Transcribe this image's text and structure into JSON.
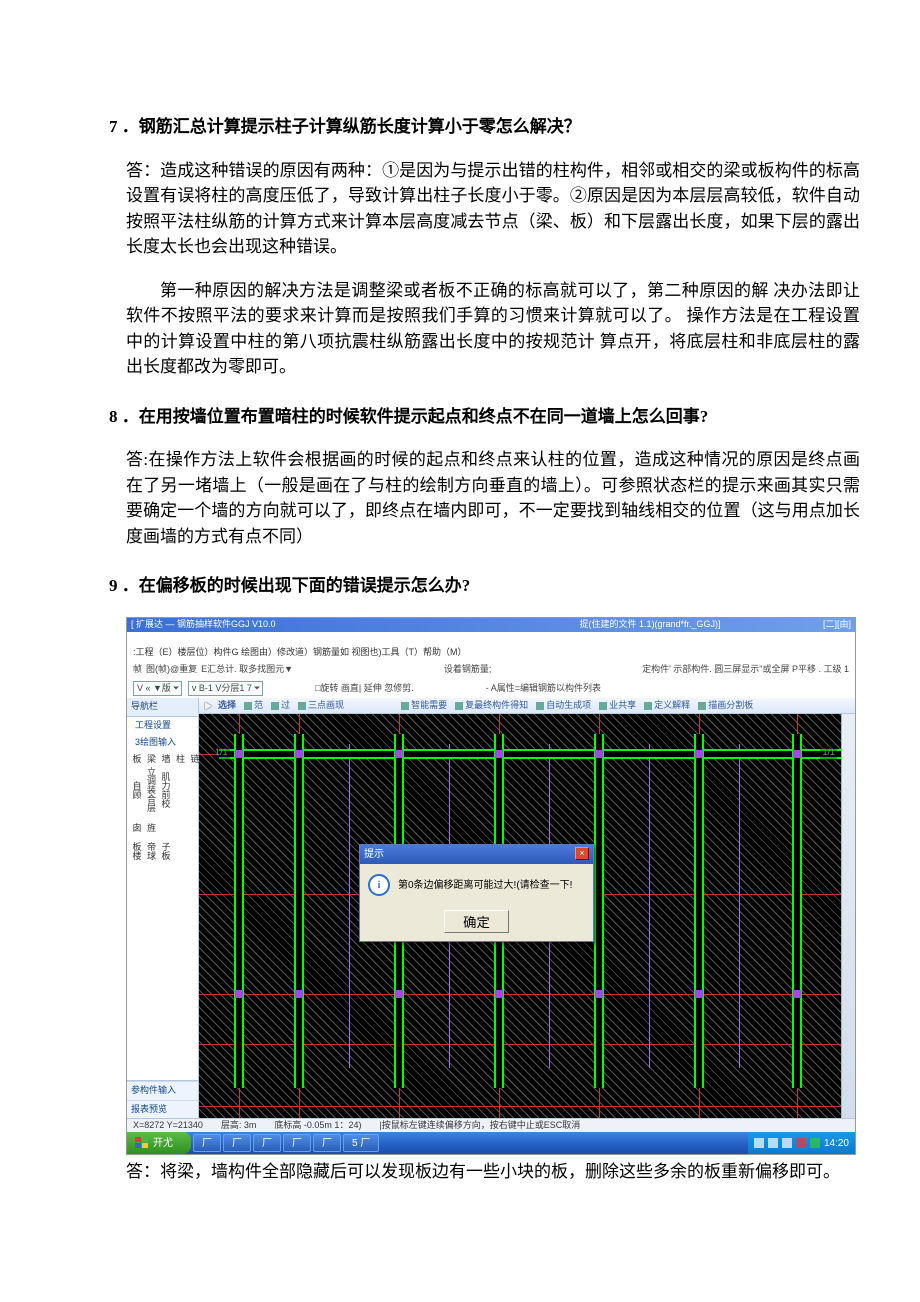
{
  "q7": {
    "title": "7 ．钢筋汇总计算提示柱子计算纵筋长度计算小于零怎么解决？",
    "p1": "答：造成这种错误的原因有两种：①是因为与提示出错的柱构件，相邻或相交的梁或板构件的标高设置有误将柱的高度压低了，导致计算出柱子长度小于零。②原因是因为本层层高较低，软件自动按照平法柱纵筋的计算方式来计算本层高度减去节点（梁、板）和下层露出长度，如果下层的露出长度太长也会出现这种错误。",
    "p2": "第一种原因的解决方法是调整梁或者板不正确的标高就可以了，第二种原因的解  决办法即让软件不按照平法的要求来计算而是按照我们手算的习惯来计算就可以了。 操作方法是在工程设置中的计算设置中柱的第八项抗震柱纵筋露出长度中的按规范计    算点开，将底层柱和非底层柱的露出长度都改为零即可。"
  },
  "q8": {
    "title": "8 ．在用按墙位置布置暗柱的时候软件提示起点和终点不在同一道墙上怎么回事?",
    "p1": "答:在操作方法上软件会根据画的时候的起点和终点来认柱的位置，造成这种情况的原因是终点画在了另一堵墙上（一般是画在了与柱的绘制方向垂直的墙上）。可参照状态栏的提示来画其实只需要确定一个墙的方向就可以了，即终点在墙内即可，不一定要找到轴线相交的位置（这与用点加长度画墙的方式有点不同）"
  },
  "q9": {
    "title": "9 ．在偏移板的时候出现下面的错误提示怎么办?",
    "answer": "答：将梁，墙构件全部隐藏后可以发现板边有一些小块的板，删除这些多余的板重新偏移即可。"
  },
  "app": {
    "title_left": "[ 扩展达 — 钢筋抽样软件GGJ V10.0",
    "title_mid": "提(住建的文件 1.1)(grand*fr._GGJ)]",
    "title_right": "[二][由]",
    "menus": [
      ":工程（E）楼层位）构件G  绘图由）修改道）钢筋量如 视图也)工具（T）帮助（M）"
    ],
    "tb1_left": [
      "帧",
      "图(帧)@重复",
      "E汇总计. 取多找图元▼"
    ],
    "tb1_mid": "设着钢筋量;",
    "tb1_right": [
      "定构件' 示部构件. 圆三屏显示\"或全屏 P平移 . 工级 1"
    ],
    "tb2": {
      "rot": "□旋转 画直| 延伸 忽修剪.",
      "prop": "-  A属性=编辑钢筋以构件列表"
    },
    "dd1": "V « ▼版",
    "dd2": "v B-1 V分层1 7",
    "nav": {
      "header": "导航栏",
      "items": [
        "工程设置",
        "3绘图输入"
      ],
      "group_a": [
        "图",
        "链",
        "柱",
        "墙",
        "梁",
        "板",
        "肌力前校",
        "立调装合层",
        "自顾"
      ],
      "group_b": [
        "旌",
        "囱"
      ],
      "group_c": [
        "子板",
        "帝球",
        "板楼"
      ],
      "foot": [
        "参构件输入",
        "报表预览"
      ]
    },
    "ctool": {
      "select": "选择",
      "items": [
        "范",
        "过",
        "三点画现",
        "智能需要",
        "复最终构件得知",
        "自动生成项",
        "业共享",
        "定义解释",
        "描画分割板"
      ]
    },
    "labels": {
      "left_top": "1/1",
      "right_top": "1/1"
    },
    "dialog": {
      "title": "提示",
      "msg": "第0条边偏移距离可能过大!(请检查一下!",
      "ok": "确定"
    },
    "status": {
      "coord": "X=8272 Y=21340",
      "layer": "层高: 3m",
      "elev": "底标高 -0.05m 1：24)",
      "hint": "|按鼠标左键连续偏移方向，按右键中止或ESC取消"
    },
    "taskbar": {
      "start": "开尤",
      "tasks": [
        "厂",
        "厂",
        "厂",
        "厂",
        "厂",
        "5  厂"
      ],
      "clock": "14:20"
    }
  }
}
